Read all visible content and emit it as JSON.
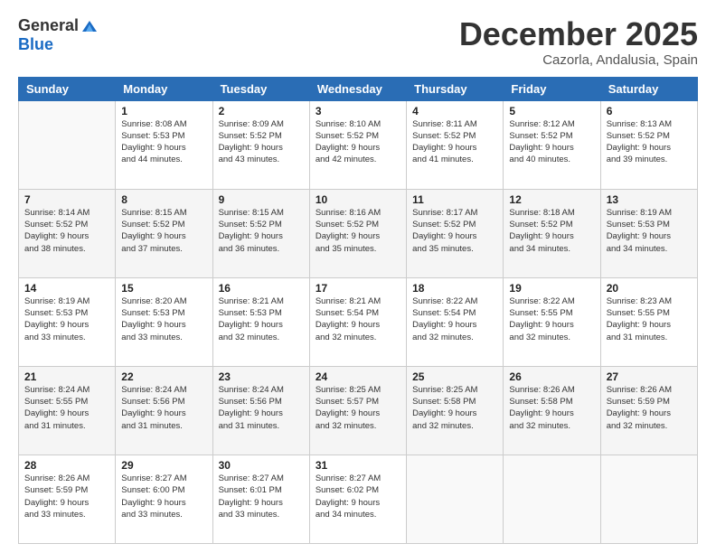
{
  "logo": {
    "general": "General",
    "blue": "Blue"
  },
  "header": {
    "month": "December 2025",
    "location": "Cazorla, Andalusia, Spain"
  },
  "weekdays": [
    "Sunday",
    "Monday",
    "Tuesday",
    "Wednesday",
    "Thursday",
    "Friday",
    "Saturday"
  ],
  "weeks": [
    [
      {
        "day": "",
        "info": ""
      },
      {
        "day": "1",
        "info": "Sunrise: 8:08 AM\nSunset: 5:53 PM\nDaylight: 9 hours\nand 44 minutes."
      },
      {
        "day": "2",
        "info": "Sunrise: 8:09 AM\nSunset: 5:52 PM\nDaylight: 9 hours\nand 43 minutes."
      },
      {
        "day": "3",
        "info": "Sunrise: 8:10 AM\nSunset: 5:52 PM\nDaylight: 9 hours\nand 42 minutes."
      },
      {
        "day": "4",
        "info": "Sunrise: 8:11 AM\nSunset: 5:52 PM\nDaylight: 9 hours\nand 41 minutes."
      },
      {
        "day": "5",
        "info": "Sunrise: 8:12 AM\nSunset: 5:52 PM\nDaylight: 9 hours\nand 40 minutes."
      },
      {
        "day": "6",
        "info": "Sunrise: 8:13 AM\nSunset: 5:52 PM\nDaylight: 9 hours\nand 39 minutes."
      }
    ],
    [
      {
        "day": "7",
        "info": "Sunrise: 8:14 AM\nSunset: 5:52 PM\nDaylight: 9 hours\nand 38 minutes."
      },
      {
        "day": "8",
        "info": "Sunrise: 8:15 AM\nSunset: 5:52 PM\nDaylight: 9 hours\nand 37 minutes."
      },
      {
        "day": "9",
        "info": "Sunrise: 8:15 AM\nSunset: 5:52 PM\nDaylight: 9 hours\nand 36 minutes."
      },
      {
        "day": "10",
        "info": "Sunrise: 8:16 AM\nSunset: 5:52 PM\nDaylight: 9 hours\nand 35 minutes."
      },
      {
        "day": "11",
        "info": "Sunrise: 8:17 AM\nSunset: 5:52 PM\nDaylight: 9 hours\nand 35 minutes."
      },
      {
        "day": "12",
        "info": "Sunrise: 8:18 AM\nSunset: 5:52 PM\nDaylight: 9 hours\nand 34 minutes."
      },
      {
        "day": "13",
        "info": "Sunrise: 8:19 AM\nSunset: 5:53 PM\nDaylight: 9 hours\nand 34 minutes."
      }
    ],
    [
      {
        "day": "14",
        "info": "Sunrise: 8:19 AM\nSunset: 5:53 PM\nDaylight: 9 hours\nand 33 minutes."
      },
      {
        "day": "15",
        "info": "Sunrise: 8:20 AM\nSunset: 5:53 PM\nDaylight: 9 hours\nand 33 minutes."
      },
      {
        "day": "16",
        "info": "Sunrise: 8:21 AM\nSunset: 5:53 PM\nDaylight: 9 hours\nand 32 minutes."
      },
      {
        "day": "17",
        "info": "Sunrise: 8:21 AM\nSunset: 5:54 PM\nDaylight: 9 hours\nand 32 minutes."
      },
      {
        "day": "18",
        "info": "Sunrise: 8:22 AM\nSunset: 5:54 PM\nDaylight: 9 hours\nand 32 minutes."
      },
      {
        "day": "19",
        "info": "Sunrise: 8:22 AM\nSunset: 5:55 PM\nDaylight: 9 hours\nand 32 minutes."
      },
      {
        "day": "20",
        "info": "Sunrise: 8:23 AM\nSunset: 5:55 PM\nDaylight: 9 hours\nand 31 minutes."
      }
    ],
    [
      {
        "day": "21",
        "info": "Sunrise: 8:24 AM\nSunset: 5:55 PM\nDaylight: 9 hours\nand 31 minutes."
      },
      {
        "day": "22",
        "info": "Sunrise: 8:24 AM\nSunset: 5:56 PM\nDaylight: 9 hours\nand 31 minutes."
      },
      {
        "day": "23",
        "info": "Sunrise: 8:24 AM\nSunset: 5:56 PM\nDaylight: 9 hours\nand 31 minutes."
      },
      {
        "day": "24",
        "info": "Sunrise: 8:25 AM\nSunset: 5:57 PM\nDaylight: 9 hours\nand 32 minutes."
      },
      {
        "day": "25",
        "info": "Sunrise: 8:25 AM\nSunset: 5:58 PM\nDaylight: 9 hours\nand 32 minutes."
      },
      {
        "day": "26",
        "info": "Sunrise: 8:26 AM\nSunset: 5:58 PM\nDaylight: 9 hours\nand 32 minutes."
      },
      {
        "day": "27",
        "info": "Sunrise: 8:26 AM\nSunset: 5:59 PM\nDaylight: 9 hours\nand 32 minutes."
      }
    ],
    [
      {
        "day": "28",
        "info": "Sunrise: 8:26 AM\nSunset: 5:59 PM\nDaylight: 9 hours\nand 33 minutes."
      },
      {
        "day": "29",
        "info": "Sunrise: 8:27 AM\nSunset: 6:00 PM\nDaylight: 9 hours\nand 33 minutes."
      },
      {
        "day": "30",
        "info": "Sunrise: 8:27 AM\nSunset: 6:01 PM\nDaylight: 9 hours\nand 33 minutes."
      },
      {
        "day": "31",
        "info": "Sunrise: 8:27 AM\nSunset: 6:02 PM\nDaylight: 9 hours\nand 34 minutes."
      },
      {
        "day": "",
        "info": ""
      },
      {
        "day": "",
        "info": ""
      },
      {
        "day": "",
        "info": ""
      }
    ]
  ]
}
